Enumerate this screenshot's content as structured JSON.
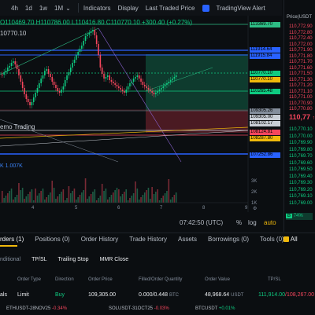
{
  "toolbar": {
    "interval_4h": "4h",
    "interval_1d": "1d",
    "interval_1w": "1w",
    "interval_1m": "1M",
    "indicators": "Indicators",
    "display": "Display",
    "price_type": "Last Traded Price",
    "tv_alert": "TradingView Alert"
  },
  "chart": {
    "ohlc_line": "O110469.70 H110786.00 L110416.80 C110770.10 +300.40 (+0.27%)",
    "ohlc_second": "10770.10",
    "demo_label": "emo Trading",
    "volume_label": "K  1.007K",
    "x_ticks": [
      "4",
      "5",
      "6",
      "7",
      "8",
      "9"
    ],
    "price_labels": [
      {
        "text": "113369.70",
        "bg": "#2ebd85"
      },
      {
        "text": "111914.64",
        "bg": "#2962ff"
      },
      {
        "text": "111915.84",
        "bg": "#2962ff"
      },
      {
        "text": "110770.10",
        "bg": "#0ecb81"
      },
      {
        "text": "110770.10",
        "bg": "#f0b90b"
      },
      {
        "text": "110265.48",
        "bg": "#0ecb81"
      },
      {
        "text": "109305.26",
        "bg": "#848e9c"
      },
      {
        "text": "109305.00",
        "bg": "#c9ced6"
      },
      {
        "text": "108102.17",
        "bg": "#c9ced6"
      },
      {
        "text": "108124.81",
        "bg": "#f6465d"
      },
      {
        "text": "108287.80",
        "bg": "#f0b90b"
      },
      {
        "text": "107252.86",
        "bg": "#2962ff"
      }
    ],
    "vol_ticks": [
      "3K",
      "2K",
      "1K"
    ]
  },
  "timebar": {
    "time": "07:42:50 (UTC)",
    "percent": "%",
    "log": "log",
    "auto": "auto"
  },
  "orderbook": {
    "header": "Price(USDT",
    "asks": [
      "110,772.90",
      "110,772.80",
      "110,772.40",
      "110,772.00",
      "110,771.90",
      "110,771.80",
      "110,771.70",
      "110,771.60",
      "110,771.50",
      "110,771.30",
      "110,771.20",
      "110,771.10",
      "110,771.00",
      "110,770.90",
      "110,770.80"
    ],
    "last": "110,77",
    "bids": [
      "110,770.10",
      "110,770.00",
      "110,769.90",
      "110,769.80",
      "110,769.70",
      "110,769.60",
      "110,769.50",
      "110,769.40",
      "110,769.30",
      "110,769.20",
      "110,769.10",
      "110,769.00"
    ],
    "ratio": "74%",
    "all_label": "All"
  },
  "bottom": {
    "tabs": [
      "rders (1)",
      "Positions (0)",
      "Order History",
      "Trade History",
      "Assets",
      "Borrowings (0)",
      "Tools (0)"
    ],
    "subtabs": [
      "nditional",
      "TP/SL",
      "Trailing Stop",
      "MMR Close"
    ],
    "headers": [
      "Order Type",
      "Direction",
      "Order Price",
      "Filled/Order Quantity",
      "Order Value",
      "TP/SL"
    ],
    "row": {
      "symbol": "als",
      "type": "Limit",
      "direction": "Buy",
      "price": "109,305.00",
      "qty": "0.000/0.448",
      "qty_unit": "BTC",
      "value": "48,968.64",
      "value_unit": "USDT",
      "tp": "111,914.00",
      "sl": "/108,267.00"
    },
    "tickers": [
      {
        "name": "ETHUSDT-28NOV25",
        "change": "-0.34%",
        "color": "#f6465d"
      },
      {
        "name": "SOLUSDT-31OCT25",
        "change": "-0.03%",
        "color": "#f6465d"
      },
      {
        "name": "BTCUSDT",
        "change": "+0.01%",
        "color": "#0ecb81"
      }
    ]
  }
}
